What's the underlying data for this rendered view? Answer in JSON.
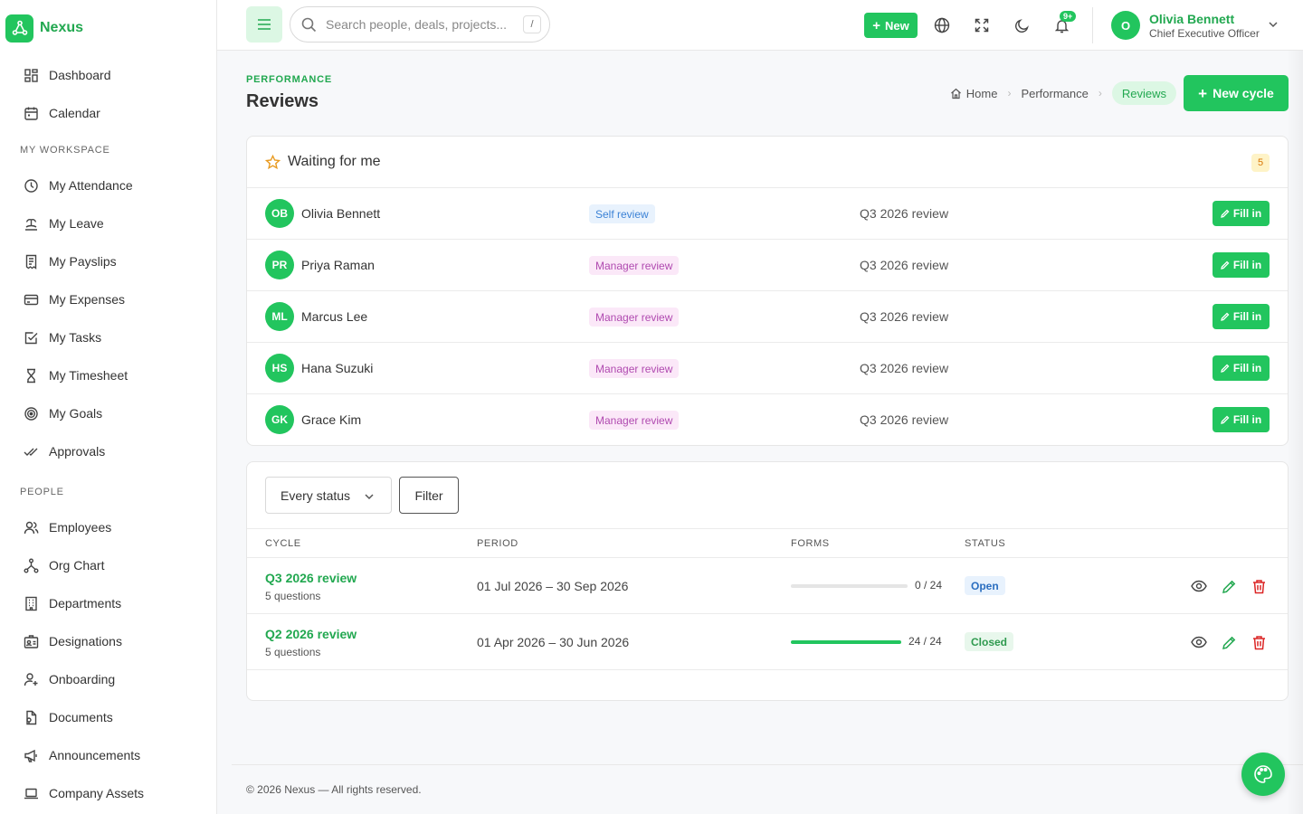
{
  "brand": {
    "name": "Nexus"
  },
  "sidebar": {
    "top_items": [
      {
        "label": "Dashboard",
        "icon": "dashboard-icon"
      },
      {
        "label": "Calendar",
        "icon": "calendar-icon"
      }
    ],
    "sections": [
      {
        "title": "MY WORKSPACE",
        "items": [
          {
            "label": "My Attendance",
            "icon": "clock-icon"
          },
          {
            "label": "My Leave",
            "icon": "leave-icon"
          },
          {
            "label": "My Payslips",
            "icon": "payslip-icon"
          },
          {
            "label": "My Expenses",
            "icon": "card-icon"
          },
          {
            "label": "My Tasks",
            "icon": "task-check-icon"
          },
          {
            "label": "My Timesheet",
            "icon": "hourglass-icon"
          },
          {
            "label": "My Goals",
            "icon": "target-icon"
          },
          {
            "label": "Approvals",
            "icon": "double-check-icon"
          }
        ]
      },
      {
        "title": "PEOPLE",
        "items": [
          {
            "label": "Employees",
            "icon": "users-icon"
          },
          {
            "label": "Org Chart",
            "icon": "org-chart-icon"
          },
          {
            "label": "Departments",
            "icon": "building-icon"
          },
          {
            "label": "Designations",
            "icon": "id-badge-icon"
          },
          {
            "label": "Onboarding",
            "icon": "user-plus-icon"
          },
          {
            "label": "Documents",
            "icon": "document-icon"
          },
          {
            "label": "Announcements",
            "icon": "megaphone-icon"
          },
          {
            "label": "Company Assets",
            "icon": "laptop-icon"
          }
        ]
      }
    ]
  },
  "topbar": {
    "search_placeholder": "Search people, deals, projects...",
    "search_shortcut": "/",
    "new_label": "New",
    "notification_count": "9+",
    "user": {
      "initial": "O",
      "name": "Olivia Bennett",
      "role": "Chief Executive Officer"
    }
  },
  "page": {
    "eyebrow": "PERFORMANCE",
    "title": "Reviews",
    "breadcrumb": [
      "Home",
      "Performance",
      "Reviews"
    ],
    "new_cycle_label": "New cycle"
  },
  "waiting": {
    "title": "Waiting for me",
    "count": "5",
    "fill_label": "Fill in",
    "rows": [
      {
        "initials": "OB",
        "name": "Olivia Bennett",
        "type": "Self review",
        "kind": "self",
        "cycle": "Q3 2026 review"
      },
      {
        "initials": "PR",
        "name": "Priya Raman",
        "type": "Manager review",
        "kind": "mgr",
        "cycle": "Q3 2026 review"
      },
      {
        "initials": "ML",
        "name": "Marcus Lee",
        "type": "Manager review",
        "kind": "mgr",
        "cycle": "Q3 2026 review"
      },
      {
        "initials": "HS",
        "name": "Hana Suzuki",
        "type": "Manager review",
        "kind": "mgr",
        "cycle": "Q3 2026 review"
      },
      {
        "initials": "GK",
        "name": "Grace Kim",
        "type": "Manager review",
        "kind": "mgr",
        "cycle": "Q3 2026 review"
      }
    ]
  },
  "cycles": {
    "status_select": "Every status",
    "filter_label": "Filter",
    "columns": [
      "CYCLE",
      "PERIOD",
      "FORMS",
      "STATUS"
    ],
    "rows": [
      {
        "name": "Q3 2026 review",
        "questions": "5 questions",
        "period": "01 Jul 2026 – 30 Sep 2026",
        "forms": "0 / 24",
        "progress": 0,
        "status": "Open",
        "status_kind": "open"
      },
      {
        "name": "Q2 2026 review",
        "questions": "5 questions",
        "period": "01 Apr 2026 – 30 Jun 2026",
        "forms": "24 / 24",
        "progress": 1,
        "status": "Closed",
        "status_kind": "closed"
      }
    ]
  },
  "footer": {
    "text": "© 2026 Nexus — All rights reserved."
  },
  "colors": {
    "accent": "#22c55e",
    "accent_text": "#22a850",
    "self_badge": "#3b82d6",
    "manager_badge": "#b04ab0",
    "delete": "#dc2626"
  }
}
